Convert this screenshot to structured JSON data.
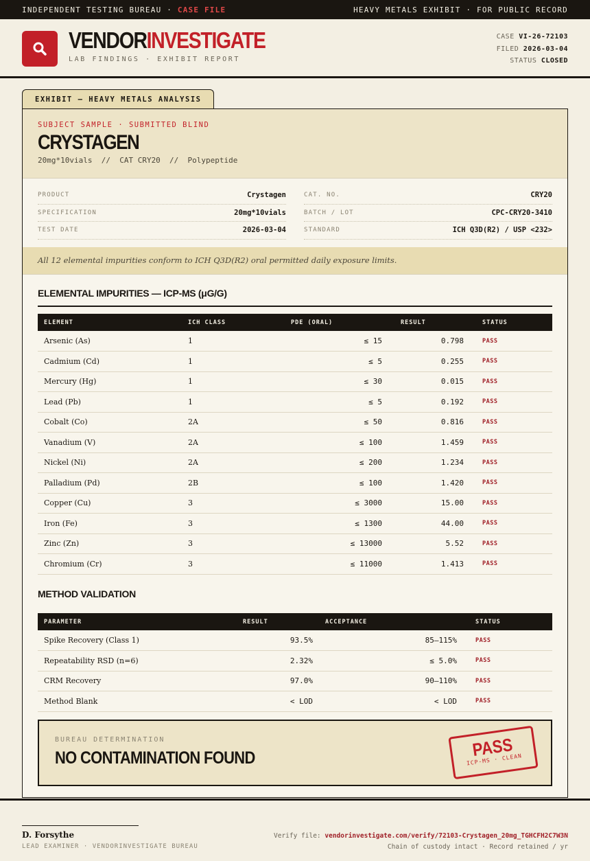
{
  "topbar": {
    "left_prefix": "INDEPENDENT TESTING BUREAU ·",
    "left_highlight": "CASE FILE",
    "right": "HEAVY METALS EXHIBIT · FOR PUBLIC RECORD"
  },
  "brand": {
    "name_part1": "VENDOR",
    "name_part2": "INVESTIGATE",
    "subtitle": "LAB FINDINGS · EXHIBIT REPORT"
  },
  "case": {
    "case_label": "CASE",
    "case_value": "VI-26-72103",
    "filed_label": "FILED",
    "filed_value": "2026-03-04",
    "status_label": "STATUS",
    "status_value": "CLOSED"
  },
  "exhibit_tab": "EXHIBIT — HEAVY METALS ANALYSIS",
  "subject": {
    "label": "SUBJECT SAMPLE · SUBMITTED BLIND",
    "title": "CRYSTAGEN",
    "spec_line": "20mg*10vials  //  CAT CRY20  //  Polypeptide"
  },
  "details": {
    "left": [
      {
        "label": "PRODUCT",
        "value": "Crystagen"
      },
      {
        "label": "SPECIFICATION",
        "value": "20mg*10vials"
      },
      {
        "label": "TEST DATE",
        "value": "2026-03-04"
      }
    ],
    "right": [
      {
        "label": "CAT. NO.",
        "value": "CRY20"
      },
      {
        "label": "BATCH / LOT",
        "value": "CPC-CRY20-3410"
      },
      {
        "label": "STANDARD",
        "value": "ICH Q3D(R2) / USP <232>"
      }
    ]
  },
  "conformance": "All 12 elemental impurities conform to ICH Q3D(R2) oral permitted daily exposure limits.",
  "impurities": {
    "title": "ELEMENTAL IMPURITIES — ICP-MS (μG/G)",
    "headers": [
      "ELEMENT",
      "ICH CLASS",
      "PDE (ORAL)",
      "RESULT",
      "STATUS"
    ],
    "rows": [
      [
        "Arsenic (As)",
        "1",
        "≤ 15",
        "0.798",
        "PASS"
      ],
      [
        "Cadmium (Cd)",
        "1",
        "≤ 5",
        "0.255",
        "PASS"
      ],
      [
        "Mercury (Hg)",
        "1",
        "≤ 30",
        "0.015",
        "PASS"
      ],
      [
        "Lead (Pb)",
        "1",
        "≤ 5",
        "0.192",
        "PASS"
      ],
      [
        "Cobalt (Co)",
        "2A",
        "≤ 50",
        "0.816",
        "PASS"
      ],
      [
        "Vanadium (V)",
        "2A",
        "≤ 100",
        "1.459",
        "PASS"
      ],
      [
        "Nickel (Ni)",
        "2A",
        "≤ 200",
        "1.234",
        "PASS"
      ],
      [
        "Palladium (Pd)",
        "2B",
        "≤ 100",
        "1.420",
        "PASS"
      ],
      [
        "Copper (Cu)",
        "3",
        "≤ 3000",
        "15.00",
        "PASS"
      ],
      [
        "Iron (Fe)",
        "3",
        "≤ 1300",
        "44.00",
        "PASS"
      ],
      [
        "Zinc (Zn)",
        "3",
        "≤ 13000",
        "5.52",
        "PASS"
      ],
      [
        "Chromium (Cr)",
        "3",
        "≤ 11000",
        "1.413",
        "PASS"
      ]
    ]
  },
  "validation": {
    "title": "METHOD VALIDATION",
    "headers": [
      "PARAMETER",
      "RESULT",
      "ACCEPTANCE",
      "STATUS"
    ],
    "rows": [
      [
        "Spike Recovery (Class 1)",
        "93.5%",
        "85–115%",
        "PASS"
      ],
      [
        "Repeatability RSD (n=6)",
        "2.32%",
        "≤ 5.0%",
        "PASS"
      ],
      [
        "CRM Recovery",
        "97.0%",
        "90–110%",
        "PASS"
      ],
      [
        "Method Blank",
        "< LOD",
        "< LOD",
        "PASS"
      ]
    ]
  },
  "determination": {
    "label": "BUREAU DETERMINATION",
    "text": "NO CONTAMINATION FOUND",
    "stamp_main": "PASS",
    "stamp_sub": "ICP-MS · CLEAN"
  },
  "footer": {
    "examiner_name": "D. Forsythe",
    "examiner_role": "LEAD EXAMINER · VENDORINVESTIGATE BUREAU",
    "verify_prefix": "Verify file:",
    "verify_url": "vendorinvestigate.com/verify/72103-Crystagen_20mg_TGHCFH2C7W3N",
    "custody_note": "Chain of custody intact · Record retained / yr"
  },
  "colors": {
    "accent_red": "#c22028",
    "ink": "#1a1611",
    "paper": "#f3efe3",
    "highlight": "#e8dcb2"
  }
}
